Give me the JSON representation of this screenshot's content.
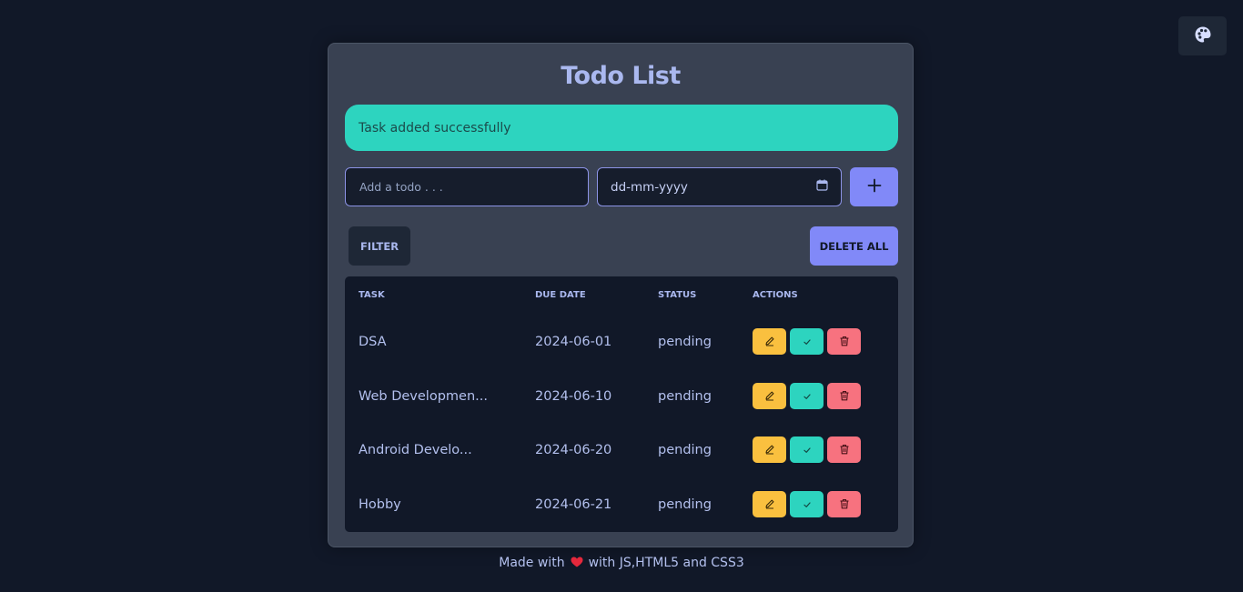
{
  "title": "Todo List",
  "alert": "Task added successfully",
  "inputs": {
    "todo_placeholder": "Add a todo . . .",
    "date_value": "dd-mm-yyyy"
  },
  "buttons": {
    "filter": "FILTER",
    "delete_all": "DELETE ALL"
  },
  "table": {
    "headers": {
      "task": "TASK",
      "due_date": "DUE DATE",
      "status": "STATUS",
      "actions": "ACTIONS"
    },
    "rows": [
      {
        "task": "DSA",
        "due": "2024-06-01",
        "status": "pending"
      },
      {
        "task": "Web Developmen...",
        "due": "2024-06-10",
        "status": "pending"
      },
      {
        "task": "Android Develo...",
        "due": "2024-06-20",
        "status": "pending"
      },
      {
        "task": "Hobby",
        "due": "2024-06-21",
        "status": "pending"
      }
    ]
  },
  "footer": {
    "before": "Made with",
    "after": "with JS,HTML5 and CSS3"
  },
  "colors": {
    "background": "#111828",
    "card": "#394152",
    "accent": "#8189f8",
    "success": "#2dd4bf",
    "edit": "#fac03f",
    "delete": "#f7727f"
  },
  "icons": [
    "palette-icon",
    "plus-icon",
    "calendar-icon",
    "pencil-icon",
    "check-icon",
    "trash-icon",
    "heart-icon"
  ]
}
